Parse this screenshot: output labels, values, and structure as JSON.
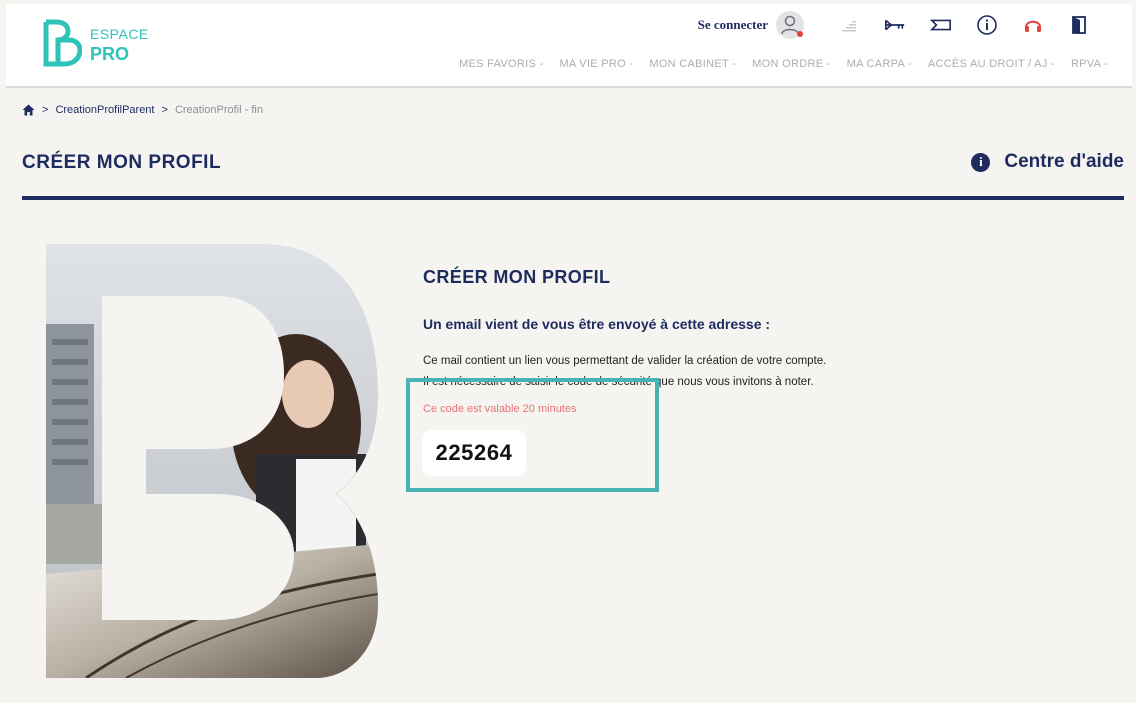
{
  "header": {
    "logo": {
      "line1": "ESPACE",
      "line2": "PRO"
    },
    "connect_label": "Se connecter",
    "icons": [
      "user-icon",
      "signal-icon",
      "key-icon",
      "tag-icon",
      "info-icon",
      "headset-icon",
      "logout-icon"
    ],
    "nav": [
      "MES FAVORIS -",
      "MA VIE PRO -",
      "MON CABINET -",
      "MON ORDRE -",
      "MA CARPA -",
      "ACCÈS AU DROIT / AJ -",
      "RPVA -"
    ]
  },
  "breadcrumb": {
    "parent": "CreationProfilParent",
    "current": "CreationProfil - fin"
  },
  "page": {
    "title": "CRÉER MON PROFIL",
    "help": "Centre d'aide"
  },
  "content": {
    "title": "CRÉER MON PROFIL",
    "subtitle": "Un email vient de vous être envoyé à cette adresse :",
    "line1": "Ce mail contient un lien vous permettant de valider la création de votre compte.",
    "line2": "Il est nécessaire de saisir le code de sécurité que nous vous invitons à noter.",
    "validity": "Ce code est valable 20 minutes",
    "code": "225264"
  },
  "colors": {
    "navy": "#1d2b5e",
    "teal": "#2ec3b8",
    "highlight": "#48b3b5",
    "warning": "#e87373",
    "headset": "#e2413a"
  }
}
